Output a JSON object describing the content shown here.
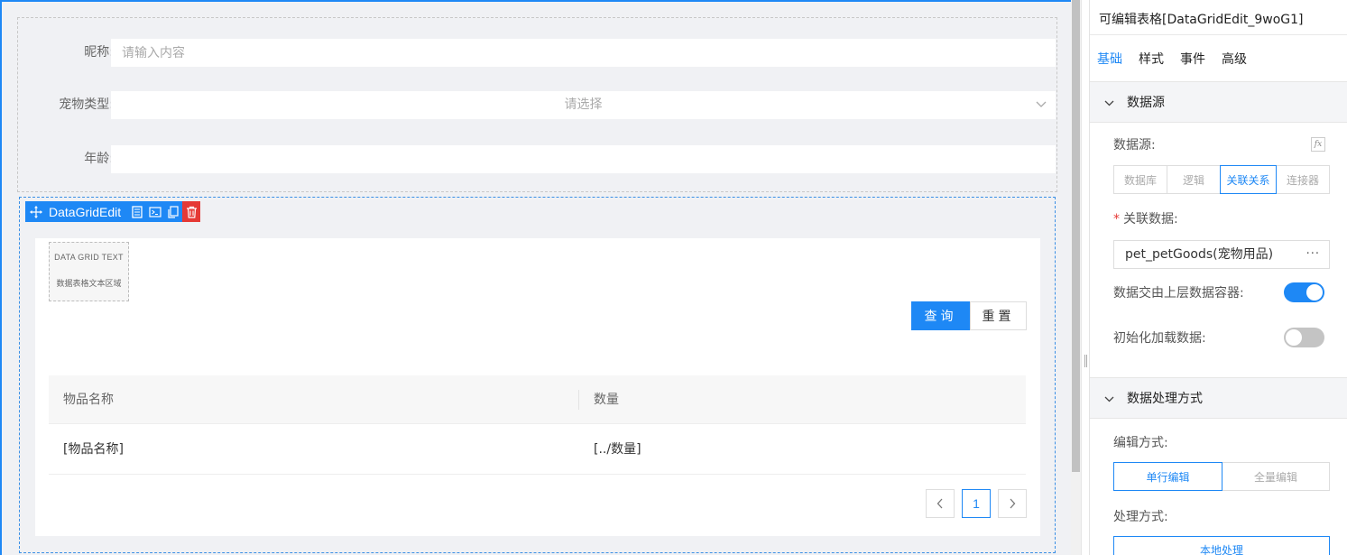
{
  "canvas": {
    "form": {
      "nickname_label": "昵称:",
      "nickname_placeholder": "请输入内容",
      "pet_type_label": "宠物类型:",
      "pet_type_placeholder": "请选择",
      "age_label": "年龄:",
      "age_value": ""
    },
    "component_toolbar": {
      "title": "DataGridEdit",
      "icons": [
        "move-icon",
        "document-icon",
        "terminal-icon",
        "copy-icon",
        "trash-icon"
      ]
    },
    "text_area": {
      "title": "DATA GRID TEXT",
      "subtitle": "数据表格文本区域"
    },
    "buttons": {
      "query": "查询",
      "reset": "重置"
    },
    "table": {
      "columns": [
        "物品名称",
        "数量"
      ],
      "rows": [
        [
          "[物品名称]",
          "[../数量]"
        ]
      ]
    },
    "pagination": {
      "prev": "‹",
      "current_page": "1",
      "next": "›"
    }
  },
  "panel": {
    "title": "可编辑表格[DataGridEdit_9woG1]",
    "tabs": [
      "基础",
      "样式",
      "事件",
      "高级"
    ],
    "active_tab": "基础",
    "datasource_section": {
      "title": "数据源",
      "datasource_label": "数据源:",
      "fx_label": "fx",
      "options": [
        "数据库",
        "逻辑",
        "关联关系",
        "连接器"
      ],
      "active_option": "关联关系",
      "relation_label": "关联数据:",
      "relation_value": "pet_petGoods(宠物用品)",
      "relation_more": "···",
      "upper_container_label": "数据交由上层数据容器:",
      "upper_container_on": true,
      "init_load_label": "初始化加载数据:",
      "init_load_on": false
    },
    "processing_section": {
      "title": "数据处理方式",
      "edit_mode_label": "编辑方式:",
      "edit_modes": [
        "单行编辑",
        "全量编辑"
      ],
      "active_edit_mode": "单行编辑",
      "process_label": "处理方式:",
      "process_value": "本地处理"
    }
  },
  "colors": {
    "accent": "#1e88f5",
    "danger": "#e53935",
    "canvas_bg": "#f0f1f4"
  }
}
